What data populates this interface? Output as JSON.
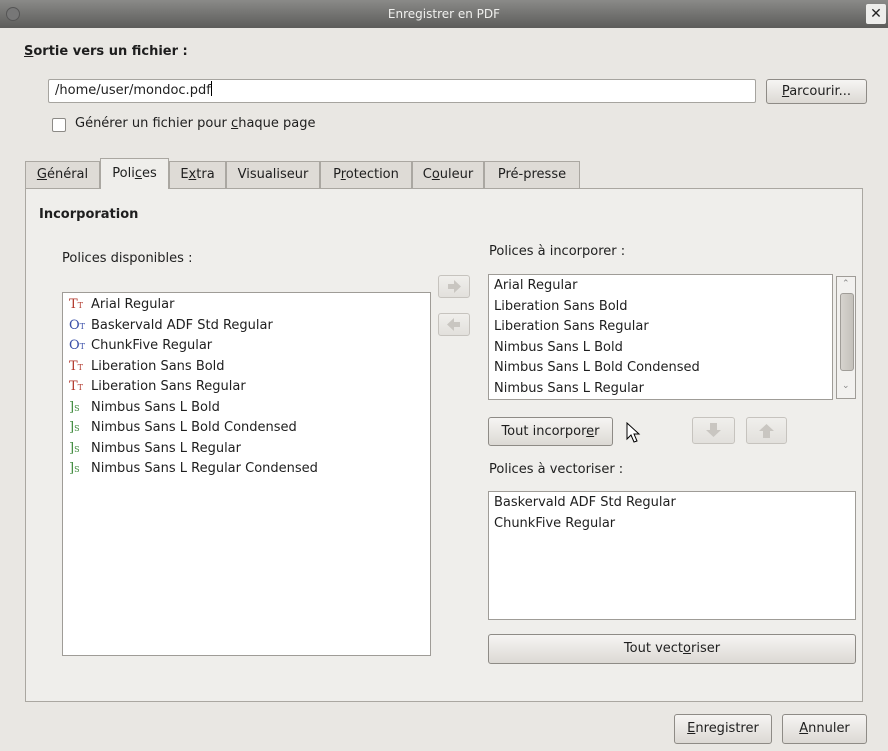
{
  "window": {
    "title": "Enregistrer en PDF",
    "close_glyph": "✕"
  },
  "output": {
    "heading": {
      "ul": "S",
      "rest": "ortie vers un fichier :"
    },
    "path_value": "/home/user/mondoc.pdf",
    "browse": {
      "ul": "P",
      "rest": "arcourir..."
    },
    "per_page": {
      "pre": "Générer un fichier pour ",
      "ul": "c",
      "post": "haque page"
    }
  },
  "tabs": [
    {
      "pre": "",
      "ul": "G",
      "post": "énéral"
    },
    {
      "pre": "Poli",
      "ul": "c",
      "post": "es"
    },
    {
      "pre": "E",
      "ul": "x",
      "post": "tra"
    },
    {
      "pre": "Visualiseur",
      "ul": "",
      "post": ""
    },
    {
      "pre": "P",
      "ul": "r",
      "post": "otection"
    },
    {
      "pre": "C",
      "ul": "o",
      "post": "uleur"
    },
    {
      "pre": "Pré-presse",
      "ul": "",
      "post": ""
    }
  ],
  "active_tab": "Polices",
  "panel": {
    "section_title": "Incorporation",
    "available_label": "Polices disponibles :",
    "embed_label": "Polices à incorporer :",
    "vector_label": "Polices à vectoriser :",
    "available_fonts": [
      {
        "icon": "truetype-font-icon",
        "glyph": "T",
        "sub": "T",
        "color": "#b23a2e",
        "name": "Arial Regular"
      },
      {
        "icon": "opentype-font-icon",
        "glyph": "O",
        "sub": "T",
        "color": "#3a4fa8",
        "name": "Baskervald ADF Std Regular"
      },
      {
        "icon": "opentype-font-icon",
        "glyph": "O",
        "sub": "T",
        "color": "#3a4fa8",
        "name": "ChunkFive Regular"
      },
      {
        "icon": "truetype-font-icon",
        "glyph": "T",
        "sub": "T",
        "color": "#b23a2e",
        "name": "Liberation Sans Bold"
      },
      {
        "icon": "truetype-font-icon",
        "glyph": "T",
        "sub": "T",
        "color": "#b23a2e",
        "name": "Liberation Sans Regular"
      },
      {
        "icon": "postscript-font-icon",
        "glyph": "]",
        "sub": "S",
        "color": "#3f8a3c",
        "name": "Nimbus Sans L Bold"
      },
      {
        "icon": "postscript-font-icon",
        "glyph": "]",
        "sub": "S",
        "color": "#3f8a3c",
        "name": "Nimbus Sans L Bold Condensed"
      },
      {
        "icon": "postscript-font-icon",
        "glyph": "]",
        "sub": "S",
        "color": "#3f8a3c",
        "name": "Nimbus Sans L Regular"
      },
      {
        "icon": "postscript-font-icon",
        "glyph": "]",
        "sub": "S",
        "color": "#3f8a3c",
        "name": "Nimbus Sans L Regular Condensed"
      }
    ],
    "embed_fonts": [
      "Arial Regular",
      "Liberation Sans Bold",
      "Liberation Sans Regular",
      "Nimbus Sans L Bold",
      "Nimbus Sans L Bold Condensed",
      "Nimbus Sans L Regular"
    ],
    "vector_fonts": [
      "Baskervald ADF Std Regular",
      "ChunkFive Regular"
    ],
    "embed_all": {
      "pre": "Tout incorpor",
      "ul": "e",
      "post": "r"
    },
    "vectorize_all": {
      "pre": "Tout vect",
      "ul": "o",
      "post": "riser"
    }
  },
  "footer": {
    "save": {
      "ul": "E",
      "rest": "nregistrer"
    },
    "cancel": {
      "ul": "A",
      "rest": "nnuler"
    }
  }
}
